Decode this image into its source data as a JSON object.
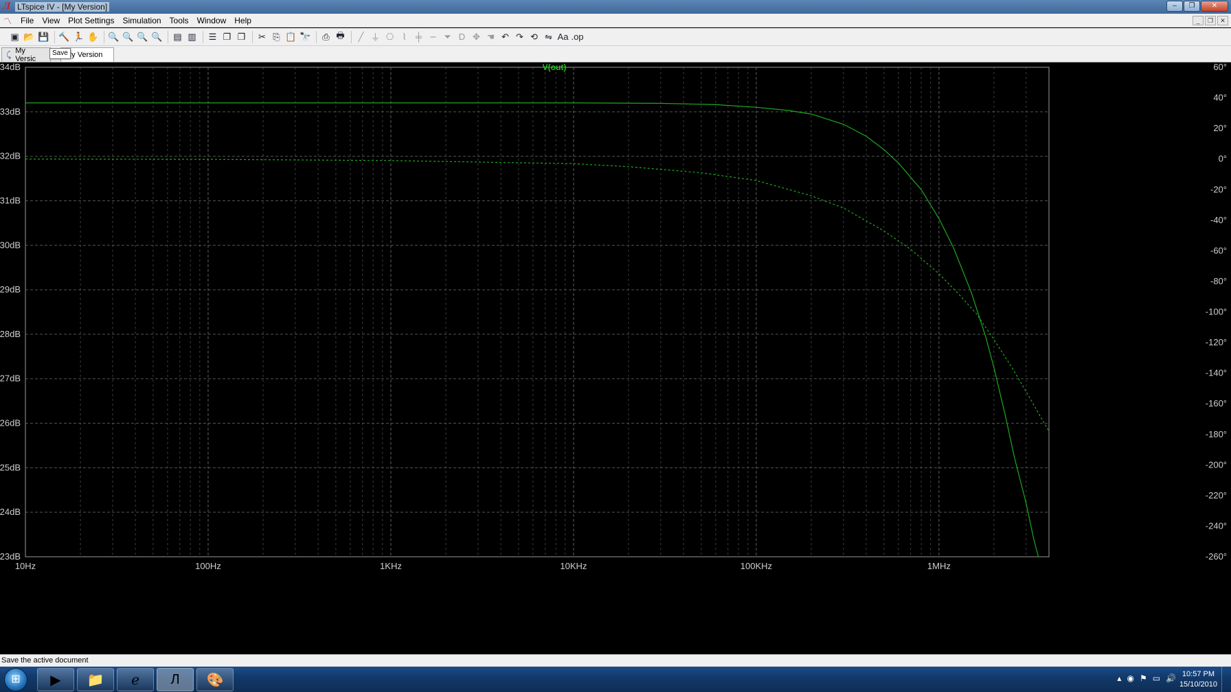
{
  "window": {
    "title": "LTspice IV - [My Version]"
  },
  "menu": {
    "items": [
      "File",
      "View",
      "Plot Settings",
      "Simulation",
      "Tools",
      "Window",
      "Help"
    ]
  },
  "toolbar": {
    "buttons": [
      {
        "icon": "new-schematic-icon",
        "glyph": "▣"
      },
      {
        "icon": "open-icon",
        "glyph": "📂"
      },
      {
        "icon": "save-icon",
        "glyph": "💾"
      },
      {
        "icon": "control-panel-icon",
        "glyph": "🔨"
      },
      {
        "icon": "run-icon",
        "glyph": "🏃"
      },
      {
        "icon": "halt-icon",
        "glyph": "✋"
      },
      {
        "icon": "zoom-in-icon",
        "glyph": "🔍"
      },
      {
        "icon": "pan-icon",
        "glyph": "🔍"
      },
      {
        "icon": "zoom-out-icon",
        "glyph": "🔍"
      },
      {
        "icon": "zoom-fit-icon",
        "glyph": "🔍"
      },
      {
        "icon": "autorange-icon",
        "glyph": "▤"
      },
      {
        "icon": "zoom-extents-icon",
        "glyph": "▥"
      },
      {
        "icon": "tile-horizontal-icon",
        "glyph": "☰"
      },
      {
        "icon": "cascade-icon",
        "glyph": "❐"
      },
      {
        "icon": "tile-vertical-icon",
        "glyph": "❐"
      },
      {
        "icon": "cut-icon",
        "glyph": "✂"
      },
      {
        "icon": "copy-icon",
        "glyph": "⎘"
      },
      {
        "icon": "paste-icon",
        "glyph": "📋"
      },
      {
        "icon": "find-icon",
        "glyph": "🔭"
      },
      {
        "icon": "print-setup-icon",
        "glyph": "⎙"
      },
      {
        "icon": "print-icon",
        "glyph": "🖶"
      },
      {
        "icon": "wire-icon",
        "glyph": "╱"
      },
      {
        "icon": "ground-icon",
        "glyph": "⏚"
      },
      {
        "icon": "label-net-icon",
        "glyph": "⎔"
      },
      {
        "icon": "resistor-icon",
        "glyph": "⌇"
      },
      {
        "icon": "capacitor-icon",
        "glyph": "╪"
      },
      {
        "icon": "inductor-icon",
        "glyph": "∽"
      },
      {
        "icon": "diode-icon",
        "glyph": "⏷"
      },
      {
        "icon": "component-icon",
        "glyph": "D"
      },
      {
        "icon": "move-icon",
        "glyph": "✥"
      },
      {
        "icon": "drag-icon",
        "glyph": "☚"
      },
      {
        "icon": "undo-icon",
        "glyph": "↶"
      },
      {
        "icon": "redo-icon",
        "glyph": "↷"
      },
      {
        "icon": "rotate-icon",
        "glyph": "⟲"
      },
      {
        "icon": "mirror-icon",
        "glyph": "⇋"
      },
      {
        "icon": "text-icon",
        "glyph": "Aa"
      },
      {
        "icon": "spice-directive-icon",
        "glyph": ".op"
      }
    ]
  },
  "tabs": [
    {
      "label": "My Versic",
      "active": false
    },
    {
      "label": "My Version",
      "active": true
    }
  ],
  "tooltip": "Save",
  "status": "Save the active document",
  "clock": {
    "time": "10:57 PM",
    "date": "15/10/2010"
  },
  "chart_data": {
    "type": "line",
    "title": "V(out)",
    "x_scale": "log",
    "xlim": [
      10,
      4000000
    ],
    "x_ticks": [
      10,
      100,
      1000,
      10000,
      100000,
      1000000
    ],
    "x_tick_labels": [
      "10Hz",
      "100Hz",
      "1KHz",
      "10KHz",
      "100KHz",
      "1MHz"
    ],
    "y_left": {
      "lim": [
        23,
        34
      ],
      "ticks": [
        23,
        24,
        25,
        26,
        27,
        28,
        29,
        30,
        31,
        32,
        33,
        34
      ],
      "tick_labels": [
        "23dB",
        "24dB",
        "25dB",
        "26dB",
        "27dB",
        "28dB",
        "29dB",
        "30dB",
        "31dB",
        "32dB",
        "33dB",
        "34dB"
      ]
    },
    "y_right": {
      "lim": [
        -260,
        60
      ],
      "ticks": [
        -260,
        -240,
        -220,
        -200,
        -180,
        -160,
        -140,
        -120,
        -100,
        -80,
        -60,
        -40,
        -20,
        0,
        20,
        40,
        60
      ],
      "tick_labels": [
        "-260°",
        "-240°",
        "-220°",
        "-200°",
        "-180°",
        "-160°",
        "-140°",
        "-120°",
        "-100°",
        "-80°",
        "-60°",
        "-40°",
        "-20°",
        "0°",
        "20°",
        "40°",
        "60°"
      ]
    },
    "grid": true,
    "series": [
      {
        "name": "V(out) magnitude",
        "axis": "left",
        "style": "solid",
        "color": "#1faa1f",
        "x": [
          10,
          100,
          1000,
          10000,
          30000,
          60000,
          100000,
          150000,
          200000,
          300000,
          400000,
          500000,
          600000,
          800000,
          1000000,
          1200000,
          1500000,
          1800000,
          2000000,
          2300000,
          2600000,
          3000000,
          3300000,
          3500000
        ],
        "y": [
          33.2,
          33.2,
          33.2,
          33.2,
          33.19,
          33.16,
          33.1,
          33.03,
          32.95,
          32.72,
          32.45,
          32.15,
          31.85,
          31.25,
          30.6,
          29.95,
          28.95,
          27.95,
          27.25,
          26.2,
          25.2,
          24.2,
          23.4,
          23.0
        ]
      },
      {
        "name": "V(out) phase",
        "axis": "right",
        "style": "dashed",
        "color": "#1faa1f",
        "x": [
          10,
          100,
          1000,
          10000,
          20000,
          50000,
          100000,
          200000,
          300000,
          500000,
          700000,
          1000000,
          1300000,
          1600000,
          2000000,
          2500000,
          3000000,
          3500000,
          4000000
        ],
        "y": [
          0,
          -0.2,
          -1,
          -3,
          -5,
          -9,
          -14,
          -24,
          -32,
          -47,
          -59,
          -75,
          -89,
          -101,
          -118,
          -136,
          -152,
          -166,
          -178
        ]
      }
    ]
  }
}
